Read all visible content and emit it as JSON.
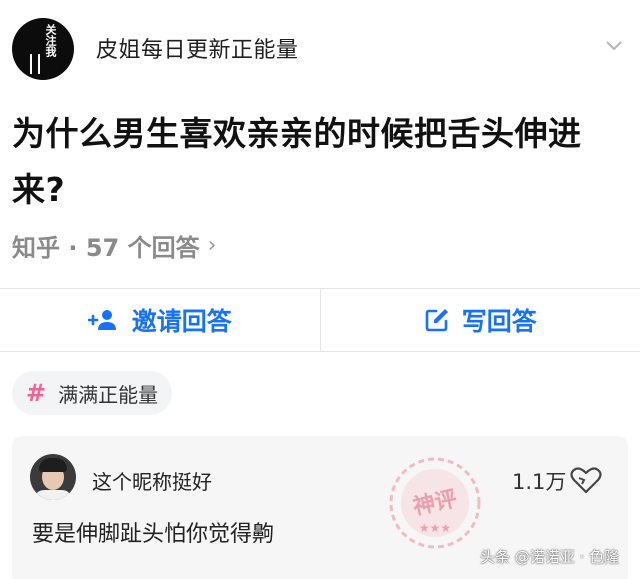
{
  "header": {
    "avatar_text": "关注我",
    "title": "皮姐每日更新正能量"
  },
  "question": {
    "title": "为什么男生喜欢亲亲的时候把舌头伸进来?"
  },
  "meta": {
    "text": "知乎 · 57 个回答"
  },
  "actions": {
    "invite_label": "邀请回答",
    "write_label": "写回答",
    "accent": "#1772f6"
  },
  "tag": {
    "label": "满满正能量",
    "hash_color": "#f06595"
  },
  "comment": {
    "username": "这个昵称挺好",
    "likes": "1.1万",
    "text": "要是伸脚趾头怕你觉得齁"
  },
  "stamp": {
    "text": "神评"
  },
  "watermark": {
    "text": "头条 @诺诺亚 · 色隆"
  }
}
